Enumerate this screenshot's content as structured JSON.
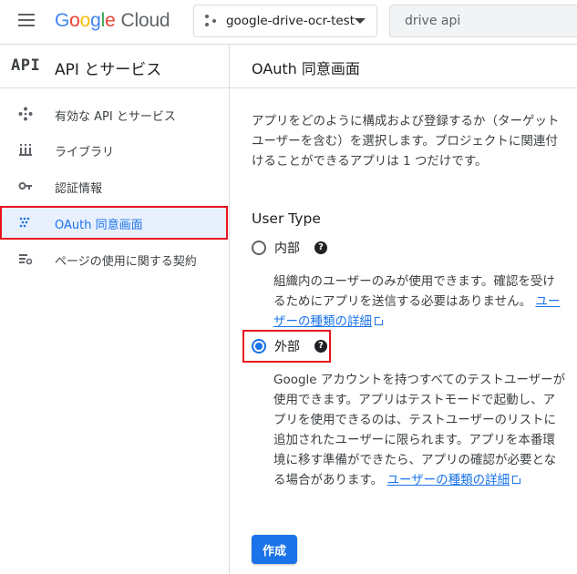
{
  "topbar": {
    "logo_google": [
      "G",
      "o",
      "o",
      "g",
      "l",
      "e"
    ],
    "logo_cloud": "Cloud",
    "project_name": "google-drive-ocr-test",
    "search_value": "drive api"
  },
  "sidebar": {
    "api_label": "API",
    "title": "API とサービス",
    "items": [
      {
        "label": "有効な API とサービス",
        "icon": "diamond-dots-icon"
      },
      {
        "label": "ライブラリ",
        "icon": "library-icon"
      },
      {
        "label": "認証情報",
        "icon": "key-icon"
      },
      {
        "label": "OAuth 同意画面",
        "icon": "consent-dots-icon",
        "active": true
      },
      {
        "label": "ページの使用に関する契約",
        "icon": "settings-list-icon"
      }
    ]
  },
  "main": {
    "page_title": "OAuth 同意画面",
    "intro": "アプリをどのように構成および登録するか（ターゲット ユーザーを含む）を選択します。プロジェクトに関連付けることができるアプリは 1 つだけです。",
    "user_type_title": "User Type",
    "options": [
      {
        "label": "内部",
        "checked": false,
        "description": "組織内のユーザーのみが使用できます。確認を受けるためにアプリを送信する必要はありません。",
        "link": "ユーザーの種類の詳細"
      },
      {
        "label": "外部",
        "checked": true,
        "description": "Google アカウントを持つすべてのテストユーザーが使用できます。アプリはテストモードで起動し、アプリを使用できるのは、テストユーザーのリストに追加されたユーザーに限られます。アプリを本番環境に移す準備ができたら、アプリの確認が必要となる場合があります。",
        "link": "ユーザーの種類の詳細"
      }
    ],
    "help_glyph": "?",
    "create_label": "作成"
  },
  "colors": {
    "accent": "#1a73e8",
    "highlight_box": "#e8121f",
    "active_nav_bg": "#e8f0fe"
  }
}
